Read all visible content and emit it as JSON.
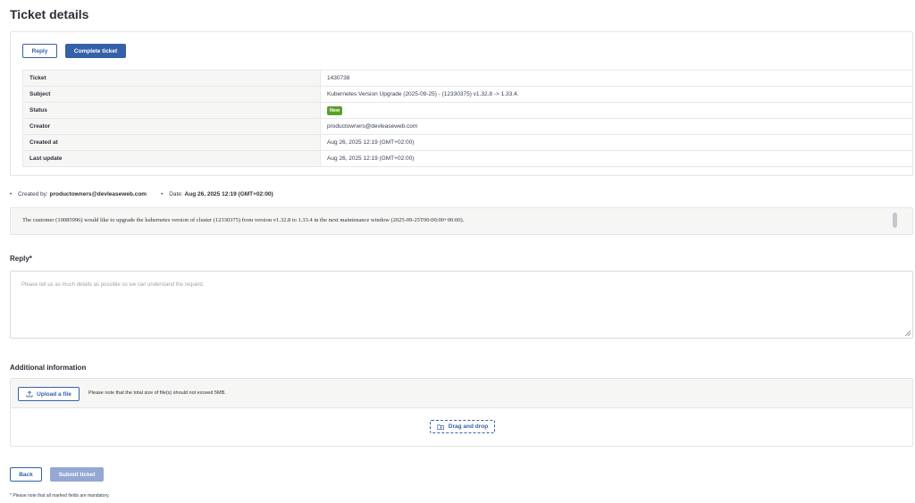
{
  "page": {
    "title": "Ticket details"
  },
  "actions": {
    "reply_label": "Reply",
    "complete_label": "Complete ticket"
  },
  "details": {
    "rows": [
      {
        "label": "Ticket",
        "value": "1430738"
      },
      {
        "label": "Subject",
        "value": "Kubernetes Version Upgrade (2025-09-25) - (12330375) v1.32.8 -> 1.33.4."
      },
      {
        "label": "Status",
        "value": "New"
      },
      {
        "label": "Creator",
        "value": "productowners@devleaseweb.com"
      },
      {
        "label": "Created at",
        "value": "Aug 26, 2025 12:19 (GMT+02:00)"
      },
      {
        "label": "Last update",
        "value": "Aug 26, 2025 12:19 (GMT+02:00)"
      }
    ],
    "status_color": "#5aa02c"
  },
  "meta": {
    "created_by_label": "Created by:",
    "created_by_value": "productowners@devleaseweb.com",
    "date_label": "Date:",
    "date_value": "Aug 26, 2025 12:19 (GMT+02:00)"
  },
  "message": {
    "text": "The customer (10085996) would like to upgrade the kubernetes version of cluster (12330375) from version v1.32.8 to 1.33.4 in the next maintenance window (2025-09-25T00:00:00+00:00)."
  },
  "reply": {
    "title": "Reply*",
    "placeholder": "Please tell us as much details as possible so we can understand the request."
  },
  "additional": {
    "title": "Additional information",
    "upload_label": "Upload a file",
    "upload_icon": "upload-icon",
    "note": "Please note that the total size of file(s) should not exceed 5MB.",
    "drag_label": "Drag and drop",
    "drag_icon": "file-drop-icon"
  },
  "footer": {
    "back_label": "Back",
    "submit_label": "Submit ticket",
    "note": "* Please note that all marked fields are mandatory."
  },
  "colors": {
    "accent": "#3561a8",
    "disabled": "#93a8d4"
  }
}
